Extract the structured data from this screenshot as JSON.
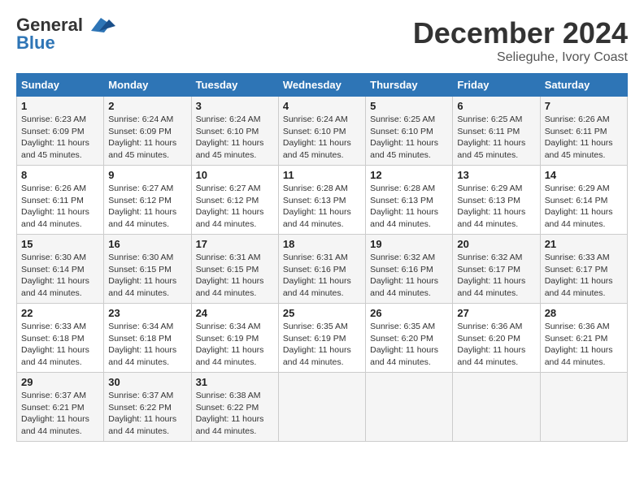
{
  "header": {
    "logo_general": "General",
    "logo_blue": "Blue",
    "month_year": "December 2024",
    "location": "Selieguhe, Ivory Coast"
  },
  "weekdays": [
    "Sunday",
    "Monday",
    "Tuesday",
    "Wednesday",
    "Thursday",
    "Friday",
    "Saturday"
  ],
  "weeks": [
    [
      {
        "day": "1",
        "sunrise": "6:23 AM",
        "sunset": "6:09 PM",
        "daylight": "11 hours and 45 minutes."
      },
      {
        "day": "2",
        "sunrise": "6:24 AM",
        "sunset": "6:09 PM",
        "daylight": "11 hours and 45 minutes."
      },
      {
        "day": "3",
        "sunrise": "6:24 AM",
        "sunset": "6:10 PM",
        "daylight": "11 hours and 45 minutes."
      },
      {
        "day": "4",
        "sunrise": "6:24 AM",
        "sunset": "6:10 PM",
        "daylight": "11 hours and 45 minutes."
      },
      {
        "day": "5",
        "sunrise": "6:25 AM",
        "sunset": "6:10 PM",
        "daylight": "11 hours and 45 minutes."
      },
      {
        "day": "6",
        "sunrise": "6:25 AM",
        "sunset": "6:11 PM",
        "daylight": "11 hours and 45 minutes."
      },
      {
        "day": "7",
        "sunrise": "6:26 AM",
        "sunset": "6:11 PM",
        "daylight": "11 hours and 45 minutes."
      }
    ],
    [
      {
        "day": "8",
        "sunrise": "6:26 AM",
        "sunset": "6:11 PM",
        "daylight": "11 hours and 44 minutes."
      },
      {
        "day": "9",
        "sunrise": "6:27 AM",
        "sunset": "6:12 PM",
        "daylight": "11 hours and 44 minutes."
      },
      {
        "day": "10",
        "sunrise": "6:27 AM",
        "sunset": "6:12 PM",
        "daylight": "11 hours and 44 minutes."
      },
      {
        "day": "11",
        "sunrise": "6:28 AM",
        "sunset": "6:13 PM",
        "daylight": "11 hours and 44 minutes."
      },
      {
        "day": "12",
        "sunrise": "6:28 AM",
        "sunset": "6:13 PM",
        "daylight": "11 hours and 44 minutes."
      },
      {
        "day": "13",
        "sunrise": "6:29 AM",
        "sunset": "6:13 PM",
        "daylight": "11 hours and 44 minutes."
      },
      {
        "day": "14",
        "sunrise": "6:29 AM",
        "sunset": "6:14 PM",
        "daylight": "11 hours and 44 minutes."
      }
    ],
    [
      {
        "day": "15",
        "sunrise": "6:30 AM",
        "sunset": "6:14 PM",
        "daylight": "11 hours and 44 minutes."
      },
      {
        "day": "16",
        "sunrise": "6:30 AM",
        "sunset": "6:15 PM",
        "daylight": "11 hours and 44 minutes."
      },
      {
        "day": "17",
        "sunrise": "6:31 AM",
        "sunset": "6:15 PM",
        "daylight": "11 hours and 44 minutes."
      },
      {
        "day": "18",
        "sunrise": "6:31 AM",
        "sunset": "6:16 PM",
        "daylight": "11 hours and 44 minutes."
      },
      {
        "day": "19",
        "sunrise": "6:32 AM",
        "sunset": "6:16 PM",
        "daylight": "11 hours and 44 minutes."
      },
      {
        "day": "20",
        "sunrise": "6:32 AM",
        "sunset": "6:17 PM",
        "daylight": "11 hours and 44 minutes."
      },
      {
        "day": "21",
        "sunrise": "6:33 AM",
        "sunset": "6:17 PM",
        "daylight": "11 hours and 44 minutes."
      }
    ],
    [
      {
        "day": "22",
        "sunrise": "6:33 AM",
        "sunset": "6:18 PM",
        "daylight": "11 hours and 44 minutes."
      },
      {
        "day": "23",
        "sunrise": "6:34 AM",
        "sunset": "6:18 PM",
        "daylight": "11 hours and 44 minutes."
      },
      {
        "day": "24",
        "sunrise": "6:34 AM",
        "sunset": "6:19 PM",
        "daylight": "11 hours and 44 minutes."
      },
      {
        "day": "25",
        "sunrise": "6:35 AM",
        "sunset": "6:19 PM",
        "daylight": "11 hours and 44 minutes."
      },
      {
        "day": "26",
        "sunrise": "6:35 AM",
        "sunset": "6:20 PM",
        "daylight": "11 hours and 44 minutes."
      },
      {
        "day": "27",
        "sunrise": "6:36 AM",
        "sunset": "6:20 PM",
        "daylight": "11 hours and 44 minutes."
      },
      {
        "day": "28",
        "sunrise": "6:36 AM",
        "sunset": "6:21 PM",
        "daylight": "11 hours and 44 minutes."
      }
    ],
    [
      {
        "day": "29",
        "sunrise": "6:37 AM",
        "sunset": "6:21 PM",
        "daylight": "11 hours and 44 minutes."
      },
      {
        "day": "30",
        "sunrise": "6:37 AM",
        "sunset": "6:22 PM",
        "daylight": "11 hours and 44 minutes."
      },
      {
        "day": "31",
        "sunrise": "6:38 AM",
        "sunset": "6:22 PM",
        "daylight": "11 hours and 44 minutes."
      },
      null,
      null,
      null,
      null
    ]
  ]
}
